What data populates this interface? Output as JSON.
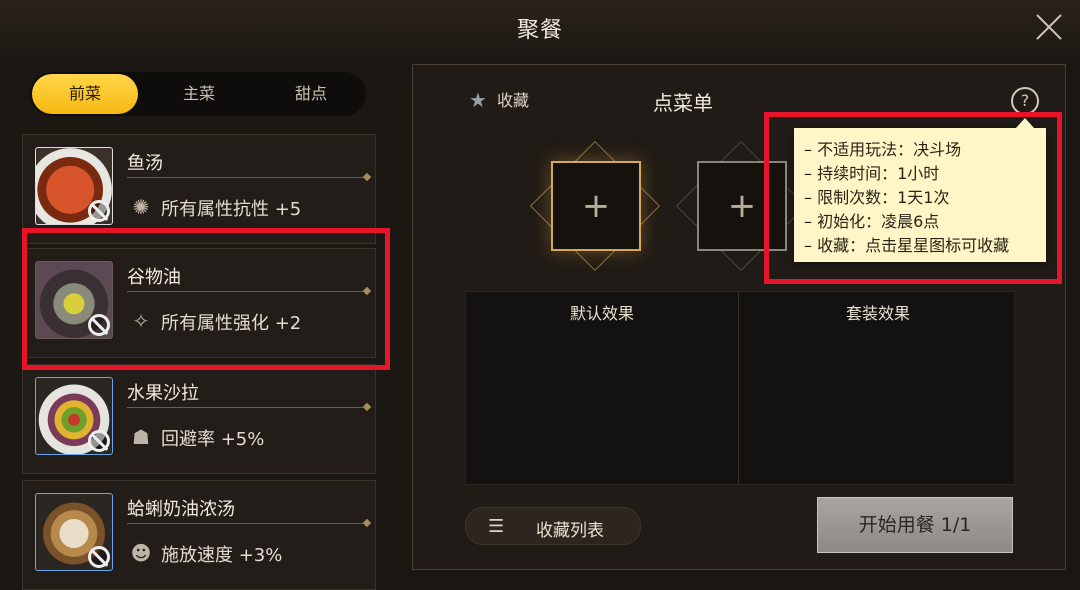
{
  "window": {
    "title": "聚餐"
  },
  "tabs": [
    {
      "label": "前菜",
      "active": true
    },
    {
      "label": "主菜",
      "active": false
    },
    {
      "label": "甜点",
      "active": false
    }
  ],
  "items": [
    {
      "name": "鱼汤",
      "effect": "所有属性抗性 +5",
      "icon": "dish-icon",
      "effect_icon": "gear-icon"
    },
    {
      "name": "谷物油",
      "effect": "所有属性强化 +2",
      "icon": "dish-icon",
      "effect_icon": "sparkle-icon"
    },
    {
      "name": "水果沙拉",
      "effect": "回避率 +5%",
      "icon": "dish-icon",
      "effect_icon": "dodge-icon"
    },
    {
      "name": "蛤蜊奶油浓汤",
      "effect": "施放速度 +3%",
      "icon": "dish-icon",
      "effect_icon": "head-icon"
    }
  ],
  "menu": {
    "favorite_label": "收藏",
    "title": "点菜单",
    "help": "?",
    "slot_plus": "+",
    "default_effect": "默认效果",
    "set_effect": "套装效果",
    "favorites_list": "收藏列表",
    "start_button": "开始用餐 1/1"
  },
  "tooltip": {
    "lines": [
      "– 不适用玩法：决斗场",
      "– 持续时间：1小时",
      "– 限制次数：1天1次",
      "– 初始化：凌晨6点",
      "– 收藏：点击星星图标可收藏"
    ]
  },
  "colors": {
    "accent": "#f5b811",
    "highlight": "#e8142a",
    "tooltip_bg": "#fff6c8"
  }
}
